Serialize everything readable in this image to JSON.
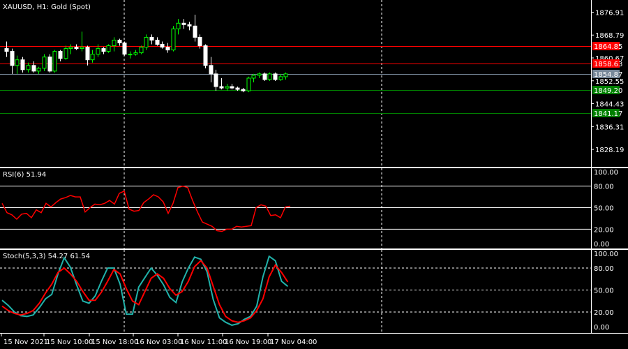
{
  "window": {
    "title": "XAUUSD, H1:  Gold (Spot)",
    "symbol": "XAUUSD",
    "timeframe": "H1",
    "description": "Gold (Spot)"
  },
  "price_scale": {
    "labels": [
      "1876.91",
      "1868.79",
      "1860.67",
      "1852.55",
      "1844.43",
      "1836.31",
      "1828.19"
    ],
    "range": [
      1823.0,
      1880.5
    ]
  },
  "level_tags": {
    "red_1": "1864.85",
    "red_2": "1858.63",
    "current": "1854.87",
    "green_1": "1849.20",
    "green_2": "1841.17"
  },
  "rsi": {
    "label": "RSI(6) 51.94",
    "scale_labels": [
      "100.00",
      "80.00",
      "50.00",
      "20.00",
      "0.00"
    ],
    "values": [
      56,
      43,
      40,
      34,
      41,
      42,
      36,
      47,
      43,
      56,
      51,
      57,
      62,
      64,
      67,
      65,
      65,
      44,
      50,
      55,
      54,
      56,
      60,
      55,
      70,
      73,
      48,
      45,
      46,
      57,
      62,
      68,
      65,
      58,
      42,
      56,
      78,
      80,
      78,
      60,
      44,
      30,
      27,
      24,
      18,
      17,
      20,
      20,
      24,
      23,
      24,
      25,
      50,
      54,
      52,
      39,
      40,
      36,
      51,
      52
    ]
  },
  "stoch": {
    "label": "Stoch(5,3,3) 54.27 61.54",
    "scale_labels": [
      "100.00",
      "80.00",
      "50.00",
      "20.00",
      "0.00"
    ],
    "main": [
      36,
      29,
      20,
      15,
      14,
      16,
      26,
      38,
      44,
      72,
      94,
      81,
      57,
      35,
      32,
      42,
      62,
      80,
      80,
      58,
      17,
      17,
      54,
      67,
      80,
      70,
      57,
      40,
      33,
      61,
      80,
      95,
      92,
      75,
      37,
      12,
      6,
      2,
      4,
      10,
      14,
      28,
      68,
      96,
      90,
      62,
      55
    ],
    "signal": [
      28,
      22,
      18,
      16,
      18,
      22,
      32,
      46,
      58,
      74,
      80,
      72,
      62,
      48,
      36,
      36,
      47,
      62,
      78,
      72,
      52,
      35,
      30,
      48,
      66,
      72,
      66,
      52,
      43,
      48,
      62,
      82,
      90,
      80,
      55,
      30,
      14,
      8,
      6,
      8,
      12,
      22,
      38,
      68,
      84,
      74,
      61
    ]
  },
  "time_axis": {
    "labels": [
      "15 Nov 2021",
      "15 Nov 10:00",
      "15 Nov 18:00",
      "16 Nov 03:00",
      "16 Nov 11:00",
      "16 Nov 19:00",
      "17 Nov 04:00"
    ]
  },
  "colors": {
    "background": "#000000",
    "bull": "#00ff00",
    "bear": "#ffffff",
    "rsi_line": "#ff0000",
    "stoch_main": "#20b2aa",
    "stoch_signal": "#ff0000",
    "resistance": "#ff0000",
    "support": "#008000",
    "current_price": "#778899"
  },
  "candles": [
    [
      1864.0,
      1866.5,
      1861.0,
      1863.0
    ],
    [
      1863.0,
      1864.0,
      1855.0,
      1858.0
    ],
    [
      1858.0,
      1861.5,
      1855.0,
      1860.0
    ],
    [
      1860.0,
      1861.0,
      1855.5,
      1856.5
    ],
    [
      1856.5,
      1859.0,
      1855.5,
      1858.0
    ],
    [
      1858.0,
      1859.5,
      1855.5,
      1856.0
    ],
    [
      1856.0,
      1857.5,
      1855.0,
      1857.0
    ],
    [
      1857.0,
      1862.0,
      1856.0,
      1861.0
    ],
    [
      1861.0,
      1862.0,
      1855.5,
      1856.0
    ],
    [
      1856.0,
      1863.5,
      1855.5,
      1863.0
    ],
    [
      1863.0,
      1863.5,
      1859.5,
      1860.5
    ],
    [
      1860.5,
      1865.0,
      1860.0,
      1864.0
    ],
    [
      1864.0,
      1865.5,
      1862.0,
      1864.5
    ],
    [
      1864.5,
      1865.5,
      1863.5,
      1864.0
    ],
    [
      1864.0,
      1870.0,
      1863.0,
      1864.5
    ],
    [
      1864.5,
      1865.0,
      1858.0,
      1860.0
    ],
    [
      1860.0,
      1863.5,
      1859.0,
      1862.0
    ],
    [
      1862.0,
      1865.5,
      1861.0,
      1864.0
    ],
    [
      1864.0,
      1864.5,
      1862.0,
      1863.0
    ],
    [
      1863.0,
      1865.5,
      1862.5,
      1865.0
    ],
    [
      1865.0,
      1868.0,
      1863.0,
      1867.0
    ],
    [
      1867.0,
      1867.5,
      1865.0,
      1866.0
    ],
    [
      1866.0,
      1866.5,
      1861.5,
      1862.0
    ],
    [
      1862.0,
      1863.0,
      1860.5,
      1862.0
    ],
    [
      1862.0,
      1863.5,
      1861.5,
      1862.5
    ],
    [
      1862.5,
      1865.0,
      1862.0,
      1864.5
    ],
    [
      1864.5,
      1869.0,
      1863.5,
      1868.0
    ],
    [
      1868.0,
      1869.0,
      1865.5,
      1867.0
    ],
    [
      1867.0,
      1868.0,
      1865.0,
      1865.5
    ],
    [
      1865.5,
      1866.5,
      1864.0,
      1864.5
    ],
    [
      1864.5,
      1866.0,
      1862.5,
      1863.5
    ],
    [
      1863.5,
      1872.0,
      1863.0,
      1871.0
    ],
    [
      1871.0,
      1874.5,
      1869.0,
      1873.0
    ],
    [
      1873.0,
      1874.5,
      1871.0,
      1872.5
    ],
    [
      1872.5,
      1873.5,
      1870.5,
      1872.0
    ],
    [
      1872.0,
      1876.0,
      1866.5,
      1868.0
    ],
    [
      1868.0,
      1869.0,
      1864.0,
      1865.0
    ],
    [
      1865.0,
      1865.5,
      1857.0,
      1858.0
    ],
    [
      1858.0,
      1861.0,
      1852.0,
      1855.0
    ],
    [
      1855.0,
      1856.5,
      1849.0,
      1850.5
    ],
    [
      1850.5,
      1853.5,
      1849.5,
      1850.0
    ],
    [
      1850.0,
      1851.5,
      1849.0,
      1850.5
    ],
    [
      1850.5,
      1851.5,
      1849.5,
      1850.0
    ],
    [
      1850.0,
      1850.5,
      1849.0,
      1849.5
    ],
    [
      1849.5,
      1850.0,
      1848.5,
      1849.0
    ],
    [
      1849.0,
      1854.0,
      1848.5,
      1853.5
    ],
    [
      1853.5,
      1855.0,
      1852.0,
      1854.5
    ],
    [
      1854.5,
      1855.5,
      1853.5,
      1855.0
    ],
    [
      1855.0,
      1855.5,
      1852.5,
      1853.0
    ],
    [
      1853.0,
      1855.5,
      1852.5,
      1855.0
    ],
    [
      1855.0,
      1855.5,
      1852.5,
      1853.0
    ],
    [
      1853.0,
      1855.0,
      1852.5,
      1854.0
    ],
    [
      1854.0,
      1855.5,
      1853.0,
      1855.0
    ]
  ]
}
